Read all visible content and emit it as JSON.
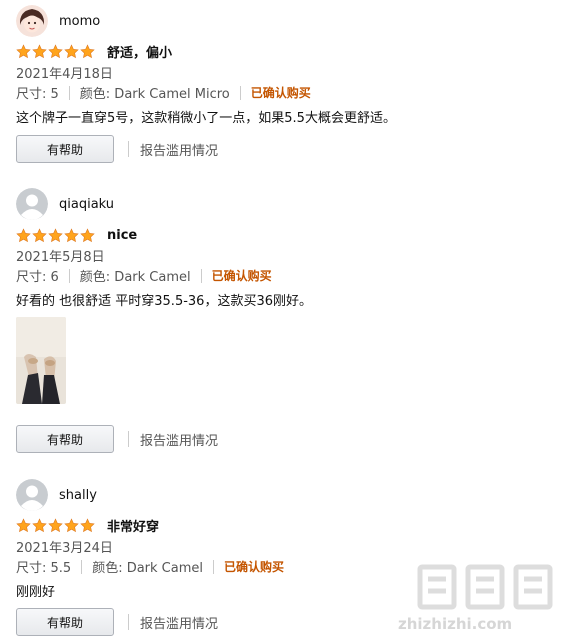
{
  "reviews": [
    {
      "author": "momo",
      "rating_stars": 5,
      "title": "舒适，偏小",
      "date": "2021年4月18日",
      "size_label": "尺寸: 5",
      "color_label": "颜色: Dark Camel Micro",
      "verified": "已确认购买",
      "body": "这个牌子一直穿5号，这款稍微小了一点，如果5.5大概会更舒适。",
      "helpful_button": "有帮助",
      "report_link": "报告滥用情况"
    },
    {
      "author": "qiaqiaku",
      "rating_stars": 5,
      "title": "nice",
      "date": "2021年5月8日",
      "size_label": "尺寸: 6",
      "color_label": "颜色: Dark Camel",
      "verified": "已确认购买",
      "body": "好看的 也很舒适 平时穿35.5-36，这款买36刚好。",
      "helpful_button": "有帮助",
      "report_link": "报告滥用情况"
    },
    {
      "author": "shally",
      "rating_stars": 5,
      "title": "非常好穿",
      "date": "2021年3月24日",
      "size_label": "尺寸: 5.5",
      "color_label": "颜色: Dark Camel",
      "verified": "已确认购买",
      "body": "刚刚好",
      "helpful_button": "有帮助",
      "report_link": "报告滥用情况"
    }
  ],
  "colors": {
    "star": "#ffa41c",
    "verified": "#c45500",
    "link": "#555555"
  },
  "watermark": {
    "text_cn": "值 值 值",
    "text_sub": "zhizhizhi.com"
  }
}
